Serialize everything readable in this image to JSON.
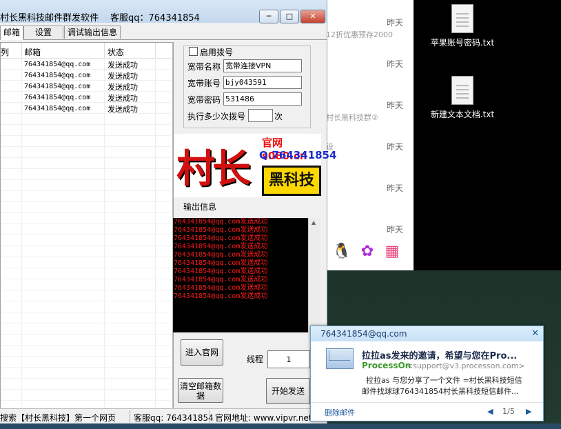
{
  "window": {
    "title": "村长黑科技邮件群发软件",
    "service_qq": "客服qq：764341854",
    "min_label": "─",
    "max_label": "□",
    "close_label": "✕"
  },
  "tabs": [
    {
      "label": "邮箱"
    },
    {
      "label": "设置"
    },
    {
      "label": "调试输出信息"
    }
  ],
  "list": {
    "columns": [
      "列",
      "邮箱",
      "状态"
    ],
    "rows": [
      {
        "email": "764341854@qq.com",
        "status": "发送成功"
      },
      {
        "email": "764341854@qq.com",
        "status": "发送成功"
      },
      {
        "email": "764341854@qq.com",
        "status": "发送成功"
      },
      {
        "email": "764341854@qq.com",
        "status": "发送成功"
      },
      {
        "email": "764341854@qq.com",
        "status": "发送成功"
      }
    ]
  },
  "dialup": {
    "enable_label": "启用拨号",
    "name_label": "宽带名称",
    "name_value": "宽带连接VPN",
    "account_label": "宽带账号",
    "account_value": "bjy043591",
    "password_label": "宽带密码",
    "password_value": "531486",
    "times_label": "执行多少次拨号",
    "times_value": "",
    "times_unit": "次"
  },
  "logo": {
    "big_text": "村长",
    "site": "官网 s080.cn",
    "qq": "Q.764341854",
    "badge": "黑科技"
  },
  "output": {
    "label": "输出信息",
    "lines": [
      "764341854@qq.com发送成功",
      "764341854@qq.com发送成功",
      "764341854@qq.com发送成功",
      "764341854@qq.com发送成功",
      "764341854@qq.com发送成功",
      "764341854@qq.com发送成功",
      "764341854@qq.com发送成功",
      "764341854@qq.com发送成功",
      "764341854@qq.com发送成功",
      "764341854@qq.com发送成功"
    ]
  },
  "controls": {
    "official_site_button": "进入官网",
    "thread_label": "线程",
    "thread_value": "1",
    "clear_button": "清空邮箱数据",
    "start_button": "开始发送"
  },
  "statusbar": {
    "search": "搜索【村长黑科技】第一个网页",
    "qq": "客服qq: 764341854",
    "site": "官网地址: www.vipvr.net"
  },
  "background_panel": {
    "dates": [
      "昨天",
      "昨天",
      "昨天",
      "昨天",
      "昨天",
      "昨天"
    ],
    "snippets": [
      "12折优惠预存2000",
      "村长黑科技群②",
      "设"
    ]
  },
  "desktop": {
    "icons": [
      {
        "name": "苹果账号密码.txt"
      },
      {
        "name": "新建文本文档.txt"
      }
    ]
  },
  "notification": {
    "account": "764341854@qq.com",
    "close_label": "✕",
    "subject": "拉拉as发来的邀请，希望与您在Pro...",
    "sender_name": "ProcessOn",
    "sender_email": "<support@v3.processon.com>",
    "body_line1": "拉拉as 与您分享了一个文件 =村长黑科技短信",
    "body_line2": "邮件找球球764341854村长黑科技短信邮件...",
    "delete_label": "删除邮件",
    "page": "1/5",
    "colors": {
      "sender": "#3a9a2a",
      "link": "#1a5a9a"
    }
  }
}
